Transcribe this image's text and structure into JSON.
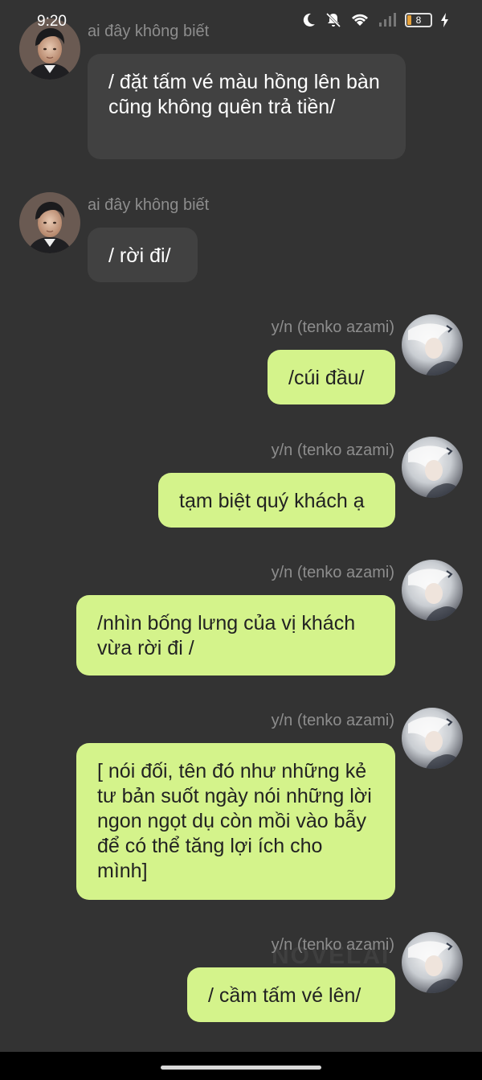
{
  "status_bar": {
    "time": "9:20",
    "battery_level": "8",
    "icons": [
      "moon-icon",
      "bell-off-icon",
      "wifi-icon",
      "signal-icon",
      "battery-icon",
      "charging-icon"
    ]
  },
  "colors": {
    "background": "#333333",
    "left_bubble": "#414141",
    "right_bubble": "#d4f38b",
    "name_text": "#8d8d8d"
  },
  "messages": [
    {
      "side": "left",
      "sender": "ai đây không biết",
      "text": "/ đặt tấm vé màu hồng lên bàn cũng không quên trả tiền/"
    },
    {
      "side": "left",
      "sender": "ai đây không biết",
      "text": "/ rời đi/"
    },
    {
      "side": "right",
      "sender": "y/n (tenko azami)",
      "text": "/cúi đầu/"
    },
    {
      "side": "right",
      "sender": "y/n (tenko azami)",
      "text": "tạm biệt quý khách ạ"
    },
    {
      "side": "right",
      "sender": "y/n (tenko azami)",
      "text": "/nhìn bống lưng của vị khách vừa rời đi /"
    },
    {
      "side": "right",
      "sender": "y/n (tenko azami)",
      "text": "[ nói đối, tên đó như những kẻ tư bản suốt ngày nói những lời ngon ngọt dụ còn mồi vào bẫy để có thể tăng lợi ích cho mình]"
    },
    {
      "side": "right",
      "sender": "y/n (tenko azami)",
      "text": "/ cầm tấm vé lên/"
    }
  ],
  "watermark": "NOVELAI"
}
